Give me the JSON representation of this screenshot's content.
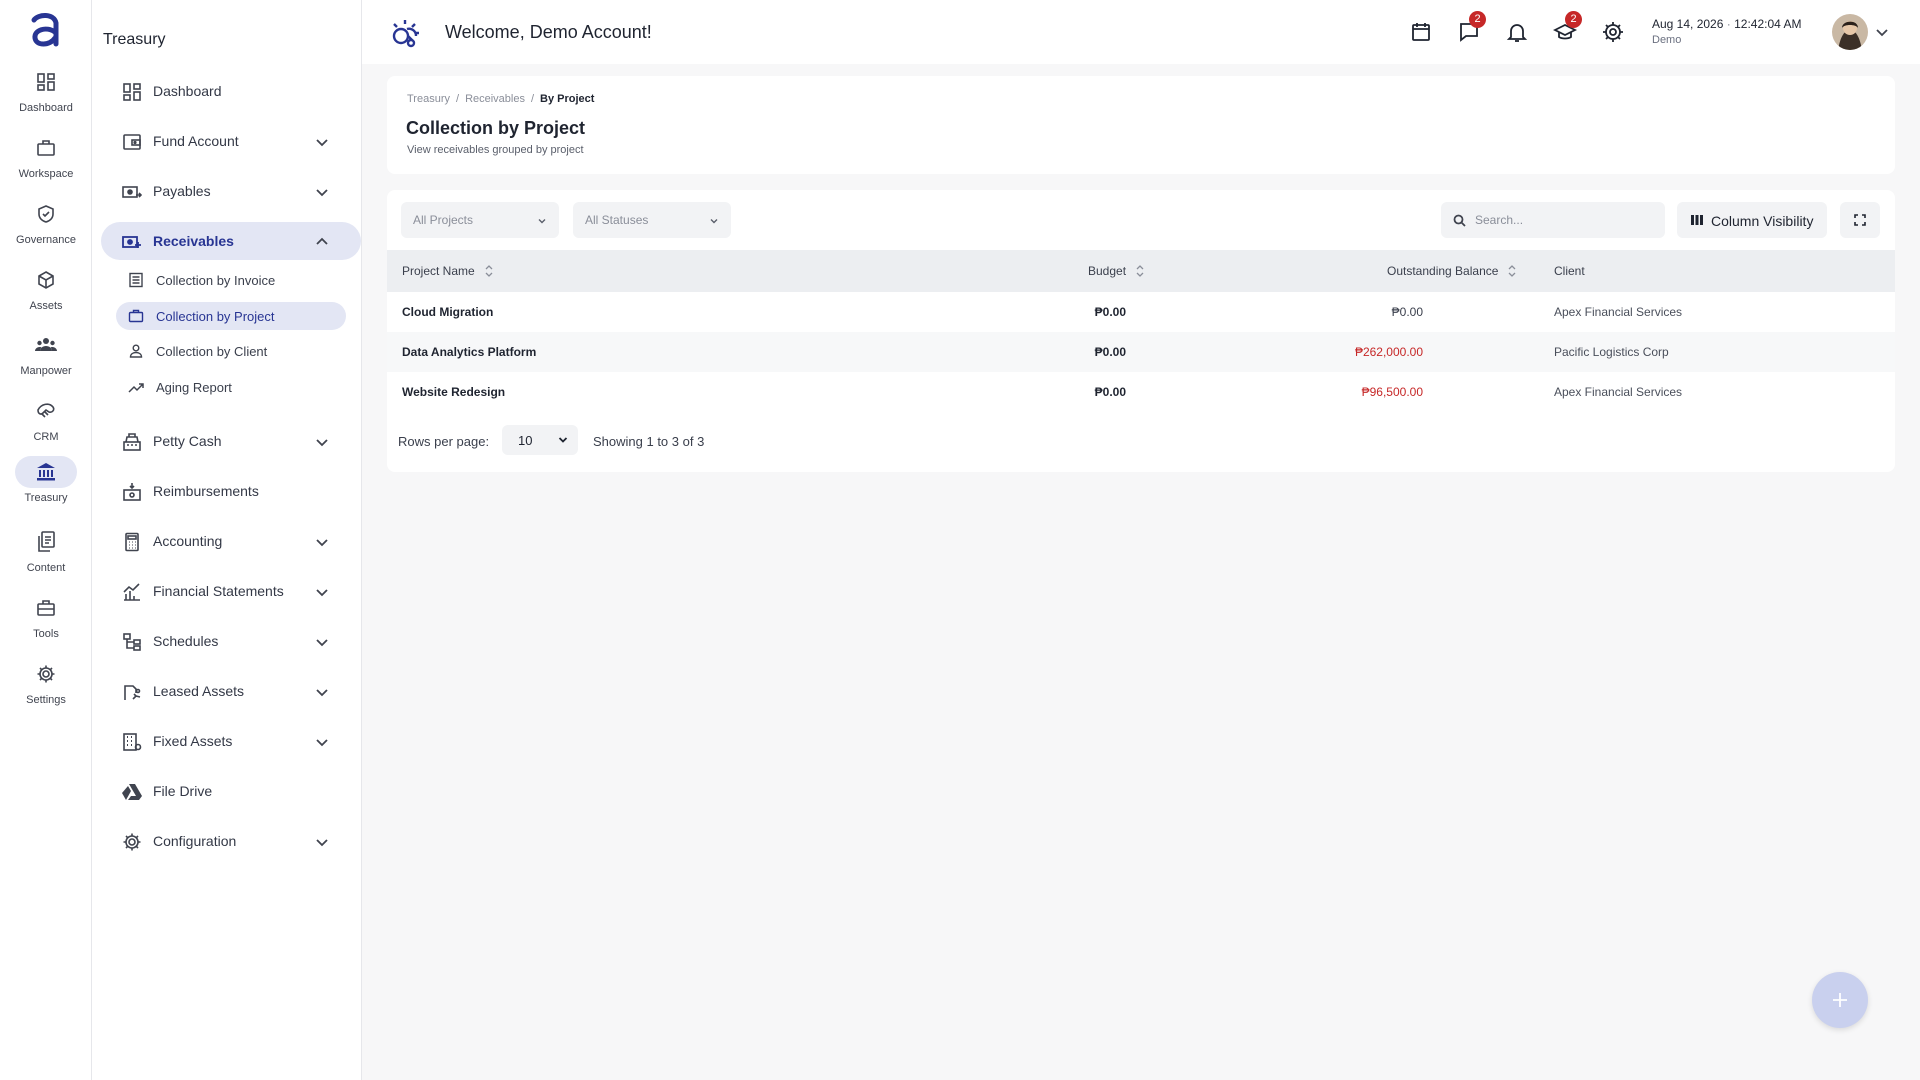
{
  "rail": {
    "items": [
      {
        "label": "Dashboard",
        "icon": "dashboard-icon"
      },
      {
        "label": "Workspace",
        "icon": "briefcase-icon"
      },
      {
        "label": "Governance",
        "icon": "shield-check-icon"
      },
      {
        "label": "Assets",
        "icon": "cube-icon"
      },
      {
        "label": "Manpower",
        "icon": "people-icon"
      },
      {
        "label": "CRM",
        "icon": "handshake-icon"
      },
      {
        "label": "Treasury",
        "icon": "bank-icon"
      },
      {
        "label": "Content",
        "icon": "documents-icon"
      },
      {
        "label": "Tools",
        "icon": "toolbox-icon"
      },
      {
        "label": "Settings",
        "icon": "gear-icon"
      }
    ],
    "active": "Treasury"
  },
  "sidebar": {
    "title": "Treasury",
    "items": [
      {
        "label": "Dashboard",
        "icon": "dashboard-icon"
      },
      {
        "label": "Fund Account",
        "icon": "wallet-icon"
      },
      {
        "label": "Payables",
        "icon": "cash-out-icon"
      },
      {
        "label": "Receivables",
        "icon": "cash-in-icon"
      },
      {
        "label": "Petty Cash",
        "icon": "cash-register-icon"
      },
      {
        "label": "Reimbursements",
        "icon": "reimburse-icon"
      },
      {
        "label": "Accounting",
        "icon": "calculator-icon"
      },
      {
        "label": "Financial Statements",
        "icon": "chart-icon"
      },
      {
        "label": "Schedules",
        "icon": "tree-icon"
      },
      {
        "label": "Leased Assets",
        "icon": "lease-icon"
      },
      {
        "label": "Fixed Assets",
        "icon": "building-icon"
      },
      {
        "label": "File Drive",
        "icon": "drive-icon"
      },
      {
        "label": "Configuration",
        "icon": "gear-icon"
      }
    ],
    "receivables_sub": [
      {
        "label": "Collection by Invoice",
        "icon": "invoice-icon"
      },
      {
        "label": "Collection by Project",
        "icon": "briefcase-icon"
      },
      {
        "label": "Collection by Client",
        "icon": "person-icon"
      },
      {
        "label": "Aging Report",
        "icon": "trend-icon"
      }
    ]
  },
  "header": {
    "welcome": "Welcome, Demo Account!",
    "messages_badge": "2",
    "training_badge": "2",
    "date": "Aug 14, 2026",
    "date_sep": "·",
    "time": "12:42:04 AM",
    "user": "Demo"
  },
  "page": {
    "breadcrumb": [
      "Treasury",
      "Receivables",
      "By Project"
    ],
    "breadcrumb_sep": "/",
    "title": "Collection by Project",
    "subtitle": "View receivables grouped by project"
  },
  "filters": {
    "projects": "All Projects",
    "statuses": "All Statuses",
    "search_placeholder": "Search...",
    "column_visibility": "Column Visibility"
  },
  "table": {
    "columns": [
      "Project Name",
      "Budget",
      "Outstanding Balance",
      "Client"
    ],
    "rows": [
      {
        "project": "Cloud Migration",
        "budget": "₱0.00",
        "outstanding": "₱0.00",
        "client": "Apex Financial Services"
      },
      {
        "project": "Data Analytics Platform",
        "budget": "₱0.00",
        "outstanding": "₱262,000.00",
        "client": "Pacific Logistics Corp"
      },
      {
        "project": "Website Redesign",
        "budget": "₱0.00",
        "outstanding": "₱96,500.00",
        "client": "Apex Financial Services"
      }
    ]
  },
  "pagination": {
    "rows_label": "Rows per page:",
    "rows_value": "10",
    "info": "Showing 1 to 3 of 3"
  },
  "colors": {
    "accent": "#283593",
    "active_bg": "#e3e6f4",
    "negative": "#c62828",
    "badge": "#c62828"
  }
}
